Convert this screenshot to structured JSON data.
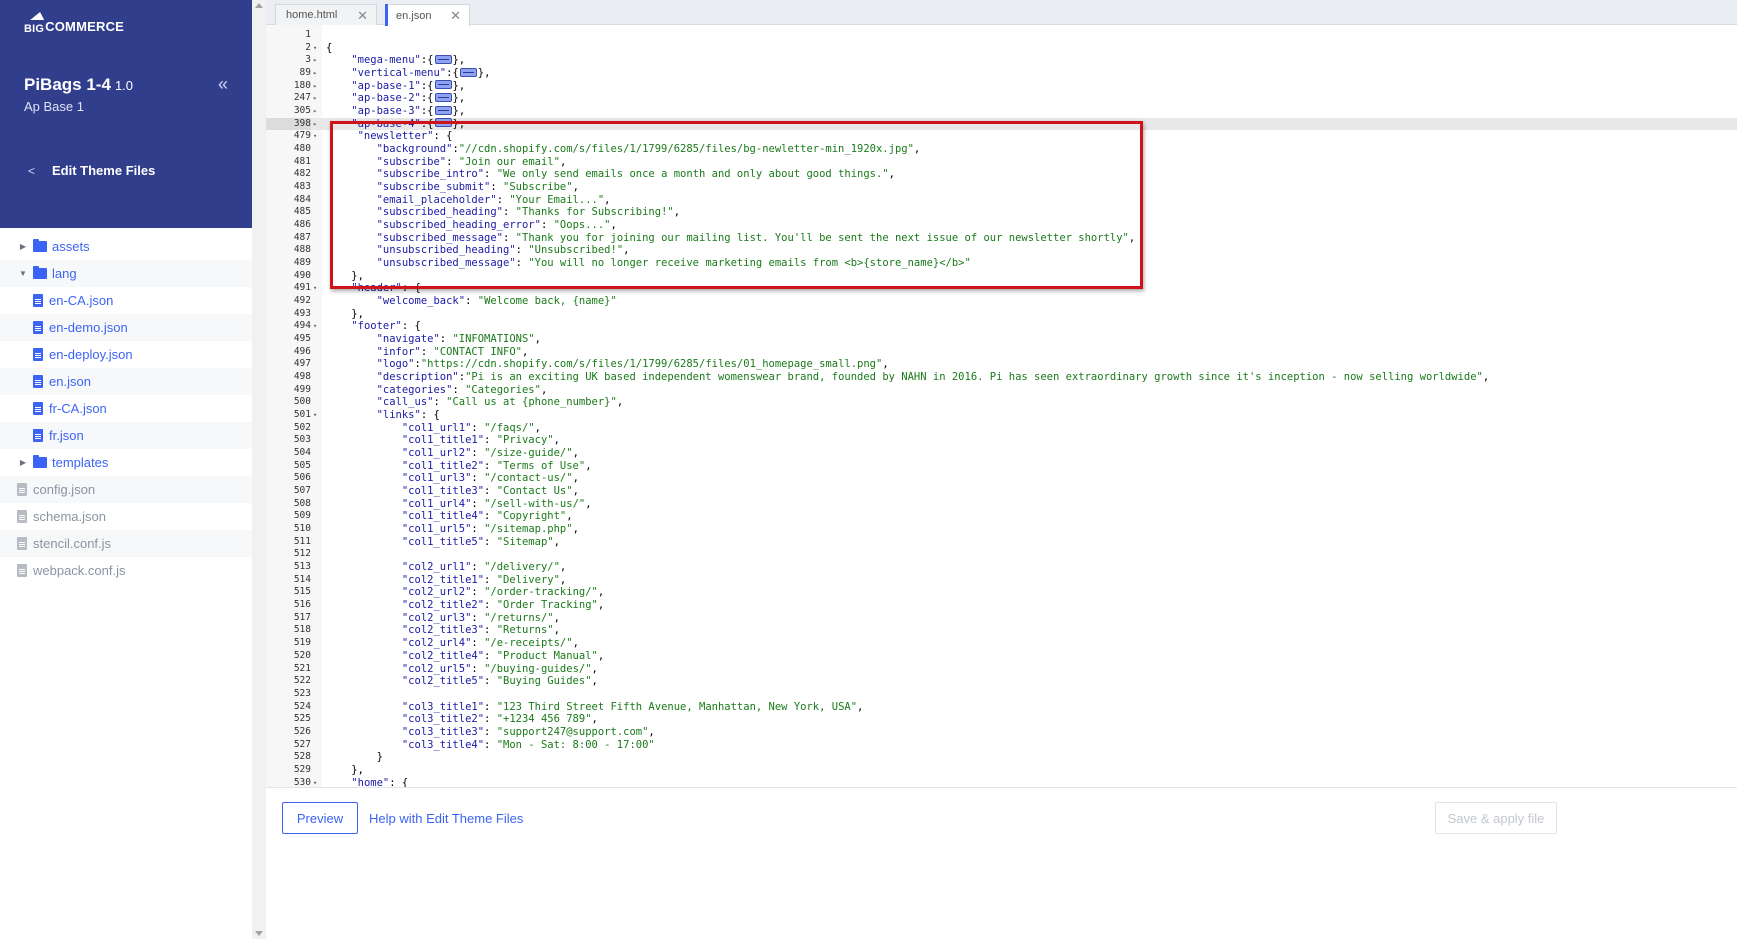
{
  "brand": {
    "logo_text_big": "BIG",
    "logo_text_rest": "COMMERCE",
    "accent": "#3c64f4",
    "header_bg": "#313e8c"
  },
  "theme": {
    "name": "PiBags 1-4",
    "version": "1.0",
    "variant": "Ap Base 1"
  },
  "nav": {
    "back_label": "Edit Theme Files",
    "collapse_icon": "double-chevron-left"
  },
  "file_tree": [
    {
      "type": "folder",
      "label": "assets",
      "expanded": false,
      "depth": 0
    },
    {
      "type": "folder",
      "label": "lang",
      "expanded": true,
      "depth": 0
    },
    {
      "type": "file",
      "label": "en-CA.json",
      "depth": 1
    },
    {
      "type": "file",
      "label": "en-demo.json",
      "depth": 1
    },
    {
      "type": "file",
      "label": "en-deploy.json",
      "depth": 1
    },
    {
      "type": "file",
      "label": "en.json",
      "depth": 1
    },
    {
      "type": "file",
      "label": "fr-CA.json",
      "depth": 1
    },
    {
      "type": "file",
      "label": "fr.json",
      "depth": 1
    },
    {
      "type": "folder",
      "label": "templates",
      "expanded": false,
      "depth": 0
    },
    {
      "type": "root-file",
      "label": "config.json",
      "depth": 0
    },
    {
      "type": "root-file",
      "label": "schema.json",
      "depth": 0
    },
    {
      "type": "root-file",
      "label": "stencil.conf.js",
      "depth": 0
    },
    {
      "type": "root-file",
      "label": "webpack.conf.js",
      "depth": 0
    }
  ],
  "tabs": [
    {
      "label": "home.html",
      "active": false
    },
    {
      "label": "en.json",
      "active": true
    }
  ],
  "code_lines": [
    {
      "n": "1",
      "fold": "",
      "t": ""
    },
    {
      "n": "2",
      "fold": "▾",
      "t": "{"
    },
    {
      "n": "3",
      "fold": "▸",
      "t": "    \"mega-menu\":{§},",
      "folded": true
    },
    {
      "n": "89",
      "fold": "▸",
      "t": "    \"vertical-menu\":{§},",
      "folded": true
    },
    {
      "n": "180",
      "fold": "▸",
      "t": "    \"ap-base-1\":{§},",
      "folded": true
    },
    {
      "n": "247",
      "fold": "▸",
      "t": "    \"ap-base-2\":{§},",
      "folded": true
    },
    {
      "n": "305",
      "fold": "▸",
      "t": "    \"ap-base-3\":{§},",
      "folded": true
    },
    {
      "n": "398",
      "fold": "▸",
      "t": "    \"ap-base-4\":{§},",
      "folded": true,
      "highlight": true
    },
    {
      "n": "479",
      "fold": "▾",
      "t": "     \"newsletter\": {"
    },
    {
      "n": "480",
      "fold": "",
      "t": "        \"background\":\"//cdn.shopify.com/s/files/1/1799/6285/files/bg-newletter-min_1920x.jpg\","
    },
    {
      "n": "481",
      "fold": "",
      "t": "        \"subscribe\": \"Join our email\","
    },
    {
      "n": "482",
      "fold": "",
      "t": "        \"subscribe_intro\": \"We only send emails once a month and only about good things.\","
    },
    {
      "n": "483",
      "fold": "",
      "t": "        \"subscribe_submit\": \"Subscribe\","
    },
    {
      "n": "484",
      "fold": "",
      "t": "        \"email_placeholder\": \"Your Email...\","
    },
    {
      "n": "485",
      "fold": "",
      "t": "        \"subscribed_heading\": \"Thanks for Subscribing!\","
    },
    {
      "n": "486",
      "fold": "",
      "t": "        \"subscribed_heading_error\": \"Oops...\","
    },
    {
      "n": "487",
      "fold": "",
      "t": "        \"subscribed_message\": \"Thank you for joining our mailing list. You'll be sent the next issue of our newsletter shortly\","
    },
    {
      "n": "488",
      "fold": "",
      "t": "        \"unsubscribed_heading\": \"Unsubscribed!\","
    },
    {
      "n": "489",
      "fold": "",
      "t": "        \"unsubscribed_message\": \"You will no longer receive marketing emails from <b>{store_name}</b>\""
    },
    {
      "n": "490",
      "fold": "",
      "t": "    },"
    },
    {
      "n": "491",
      "fold": "▾",
      "t": "    \"header\": {"
    },
    {
      "n": "492",
      "fold": "",
      "t": "        \"welcome_back\": \"Welcome back, {name}\""
    },
    {
      "n": "493",
      "fold": "",
      "t": "    },"
    },
    {
      "n": "494",
      "fold": "▾",
      "t": "    \"footer\": {"
    },
    {
      "n": "495",
      "fold": "",
      "t": "        \"navigate\": \"INFOMATIONS\","
    },
    {
      "n": "496",
      "fold": "",
      "t": "        \"infor\": \"CONTACT INFO\","
    },
    {
      "n": "497",
      "fold": "",
      "t": "        \"logo\":\"https://cdn.shopify.com/s/files/1/1799/6285/files/01_homepage_small.png\","
    },
    {
      "n": "498",
      "fold": "",
      "t": "        \"description\":\"Pi is an exciting UK based independent womenswear brand, founded by NAHN in 2016. Pi has seen extraordinary growth since it's inception - now selling worldwide\","
    },
    {
      "n": "499",
      "fold": "",
      "t": "        \"categories\": \"Categories\","
    },
    {
      "n": "500",
      "fold": "",
      "t": "        \"call_us\": \"Call us at {phone_number}\","
    },
    {
      "n": "501",
      "fold": "▾",
      "t": "        \"links\": {"
    },
    {
      "n": "502",
      "fold": "",
      "t": "            \"col1_url1\": \"/faqs/\","
    },
    {
      "n": "503",
      "fold": "",
      "t": "            \"col1_title1\": \"Privacy\","
    },
    {
      "n": "504",
      "fold": "",
      "t": "            \"col1_url2\": \"/size-guide/\","
    },
    {
      "n": "505",
      "fold": "",
      "t": "            \"col1_title2\": \"Terms of Use\","
    },
    {
      "n": "506",
      "fold": "",
      "t": "            \"col1_url3\": \"/contact-us/\","
    },
    {
      "n": "507",
      "fold": "",
      "t": "            \"col1_title3\": \"Contact Us\","
    },
    {
      "n": "508",
      "fold": "",
      "t": "            \"col1_url4\": \"/sell-with-us/\","
    },
    {
      "n": "509",
      "fold": "",
      "t": "            \"col1_title4\": \"Copyright\","
    },
    {
      "n": "510",
      "fold": "",
      "t": "            \"col1_url5\": \"/sitemap.php\","
    },
    {
      "n": "511",
      "fold": "",
      "t": "            \"col1_title5\": \"Sitemap\","
    },
    {
      "n": "512",
      "fold": "",
      "t": ""
    },
    {
      "n": "513",
      "fold": "",
      "t": "            \"col2_url1\": \"/delivery/\","
    },
    {
      "n": "514",
      "fold": "",
      "t": "            \"col2_title1\": \"Delivery\","
    },
    {
      "n": "515",
      "fold": "",
      "t": "            \"col2_url2\": \"/order-tracking/\","
    },
    {
      "n": "516",
      "fold": "",
      "t": "            \"col2_title2\": \"Order Tracking\","
    },
    {
      "n": "517",
      "fold": "",
      "t": "            \"col2_url3\": \"/returns/\","
    },
    {
      "n": "518",
      "fold": "",
      "t": "            \"col2_title3\": \"Returns\","
    },
    {
      "n": "519",
      "fold": "",
      "t": "            \"col2_url4\": \"/e-receipts/\","
    },
    {
      "n": "520",
      "fold": "",
      "t": "            \"col2_title4\": \"Product Manual\","
    },
    {
      "n": "521",
      "fold": "",
      "t": "            \"col2_url5\": \"/buying-guides/\","
    },
    {
      "n": "522",
      "fold": "",
      "t": "            \"col2_title5\": \"Buying Guides\","
    },
    {
      "n": "523",
      "fold": "",
      "t": ""
    },
    {
      "n": "524",
      "fold": "",
      "t": "            \"col3_title1\": \"123 Third Street Fifth Avenue, Manhattan, New York, USA\","
    },
    {
      "n": "525",
      "fold": "",
      "t": "            \"col3_title2\": \"+1234 456 789\","
    },
    {
      "n": "526",
      "fold": "",
      "t": "            \"col3_title3\": \"support247@support.com\","
    },
    {
      "n": "527",
      "fold": "",
      "t": "            \"col3_title4\": \"Mon - Sat: 8:00 - 17:00\""
    },
    {
      "n": "528",
      "fold": "",
      "t": "        }"
    },
    {
      "n": "529",
      "fold": "",
      "t": "    },"
    },
    {
      "n": "530",
      "fold": "▾",
      "t": "    \"home\": {"
    }
  ],
  "footer": {
    "preview_label": "Preview",
    "help_label": "Help with Edit Theme Files",
    "save_label": "Save & apply file",
    "save_enabled": false
  }
}
